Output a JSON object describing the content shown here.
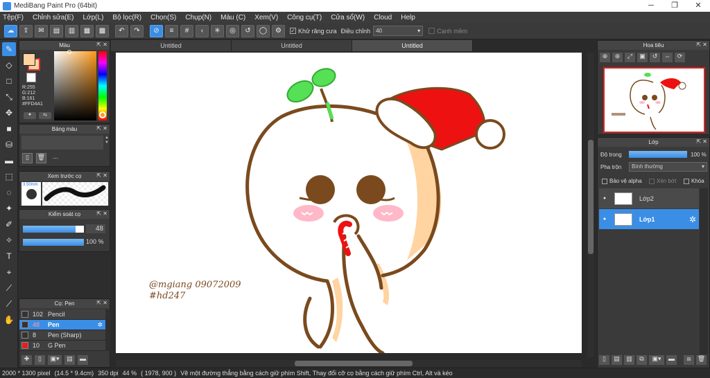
{
  "window": {
    "title": "MediBang Paint Pro (64bit)",
    "minimize": "─",
    "maximize": "❐",
    "close": "✕"
  },
  "menu": [
    "Tệp(F)",
    "Chỉnh sửa(E)",
    "Lớp(L)",
    "Bộ lọc(R)",
    "Chọn(S)",
    "Chụp(N)",
    "Màu (C)",
    "Xem(V)",
    "Công cụ(T)",
    "Cửa sổ(W)",
    "Cloud",
    "Help"
  ],
  "toolbar": {
    "antialias_label": "Khử răng cưa",
    "antialias_checked": true,
    "adjust_label": "Điều chỉnh",
    "adjust_value": "40",
    "sharpen_label": "Cạnh mềm",
    "sharpen_checked": false
  },
  "color_panel": {
    "title": "Màu",
    "r": "R:255",
    "g": "G:212",
    "b": "B:161",
    "hex": "#FFD4A1",
    "primary_color": "#ffd4a1",
    "secondary_color": "#ffffff"
  },
  "palette_panel": {
    "title": "Bảng màu",
    "empty_text": "---"
  },
  "brush_preview_panel": {
    "title": "Xem trước cọ",
    "size": "3.50mm"
  },
  "brush_control_panel": {
    "title": "Kiểm soát cọ",
    "size_value": "48",
    "size_fraction": 0.86,
    "opacity_value": "100 %",
    "opacity_fraction": 1.0
  },
  "brush_list_panel": {
    "title": "Cọ: Pen",
    "items": [
      {
        "size": "102",
        "name": "Pencil",
        "color": "#333333",
        "selected": false
      },
      {
        "size": "48",
        "name": "Pen",
        "color": "#333333",
        "selected": true
      },
      {
        "size": "8",
        "name": "Pen (Sharp)",
        "color": "#333333",
        "selected": false
      },
      {
        "size": "10",
        "name": "G Pen",
        "color": "#e02020",
        "selected": false
      }
    ]
  },
  "tabs": [
    "Untitled",
    "Untitled",
    "Untitled"
  ],
  "active_tab": 2,
  "navigator_panel": {
    "title": "Hoa tiêu"
  },
  "layer_panel": {
    "title": "Lớp",
    "opacity_label": "Độ trong",
    "opacity_value": "100 %",
    "opacity_fraction": 1.0,
    "blend_label": "Pha trộn",
    "blend_value": "Bình thường",
    "protect_alpha_label": "Bảo vệ alpha",
    "clipping_label": "Xén bớt",
    "lock_label": "Khóa",
    "layers": [
      {
        "name": "Lớp2",
        "selected": false
      },
      {
        "name": "Lớp1",
        "selected": true
      }
    ]
  },
  "artwork": {
    "signature_line1": "@mgiang 09072009",
    "signature_line2": "#hd247",
    "outline_color": "#7a4a1e",
    "skin_shadow_color": "#ffd4a1",
    "hat_color": "#ee1111",
    "sprout_color": "#55e055",
    "blush_color": "#ffb8c8"
  },
  "status": {
    "size": "2000 * 1300 pixel",
    "cm": "(14.5 * 9.4cm)",
    "dpi": "350 dpi",
    "zoom": "44 %",
    "coords": "( 1978, 900 )",
    "hint": "Vẽ một đường thẳng bằng cách giữ phím Shift, Thay đổi cỡ cọ bằng cách giữ phím Ctrl, Alt và kéo"
  }
}
